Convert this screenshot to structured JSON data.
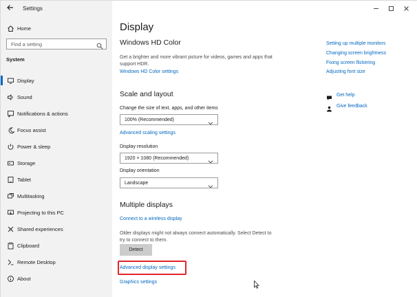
{
  "app": {
    "title": "Settings"
  },
  "sidebar": {
    "home_label": "Home",
    "search_placeholder": "Find a setting",
    "section_label": "System",
    "items": [
      {
        "label": "Display",
        "icon": "monitor-icon",
        "active": true
      },
      {
        "label": "Sound",
        "icon": "speaker-icon"
      },
      {
        "label": "Notifications & actions",
        "icon": "notification-icon"
      },
      {
        "label": "Focus assist",
        "icon": "moon-icon"
      },
      {
        "label": "Power & sleep",
        "icon": "power-icon"
      },
      {
        "label": "Storage",
        "icon": "storage-icon"
      },
      {
        "label": "Tablet",
        "icon": "tablet-icon"
      },
      {
        "label": "Multitasking",
        "icon": "multitasking-icon"
      },
      {
        "label": "Projecting to this PC",
        "icon": "projector-icon"
      },
      {
        "label": "Shared experiences",
        "icon": "shared-icon"
      },
      {
        "label": "Clipboard",
        "icon": "clipboard-icon"
      },
      {
        "label": "Remote Desktop",
        "icon": "remote-desktop-icon"
      },
      {
        "label": "About",
        "icon": "info-icon"
      }
    ]
  },
  "main": {
    "title": "Display",
    "hdr": {
      "heading": "Windows HD Color",
      "description": "Get a brighter and more vibrant picture for videos, games and apps that support HDR.",
      "link": "Windows HD Color settings"
    },
    "scale_layout": {
      "heading": "Scale and layout",
      "scale_label": "Change the size of text, apps, and other items",
      "scale_value": "100% (Recommended)",
      "advanced_scaling_link": "Advanced scaling settings",
      "resolution_label": "Display resolution",
      "resolution_value": "1920 × 1080 (Recommended)",
      "orientation_label": "Display orientation",
      "orientation_value": "Landscape"
    },
    "multiple_displays": {
      "heading": "Multiple displays",
      "wireless_link": "Connect to a wireless display",
      "description": "Older displays might not always connect automatically. Select Detect to try to connect to them.",
      "detect_button": "Detect",
      "advanced_link": "Advanced display settings",
      "graphics_link": "Graphics settings"
    }
  },
  "related": {
    "links": [
      "Setting up multiple monitors",
      "Changing screen brightness",
      "Fixing screen flickering",
      "Adjusting font size"
    ],
    "help": "Get help",
    "feedback": "Give feedback"
  },
  "colors": {
    "accent": "#0067c0",
    "highlight_box": "#e0242b",
    "sidebar_bg": "#f2f2f2"
  }
}
